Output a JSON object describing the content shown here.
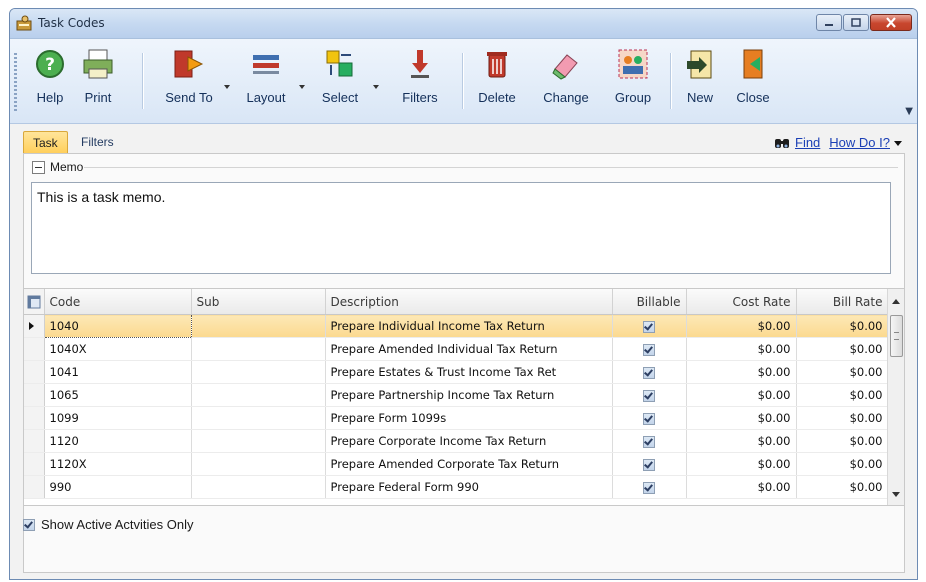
{
  "window": {
    "title": "Task Codes"
  },
  "toolbar": {
    "help": "Help",
    "print": "Print",
    "send_to": "Send To",
    "layout": "Layout",
    "select": "Select",
    "filters": "Filters",
    "delete": "Delete",
    "change": "Change",
    "group": "Group",
    "new": "New",
    "close": "Close"
  },
  "tabs": {
    "task": "Task",
    "filters": "Filters"
  },
  "links": {
    "find": "Find",
    "how_do_i": "How Do I?"
  },
  "memo": {
    "label": "Memo",
    "text": "This is a task memo."
  },
  "grid": {
    "columns": [
      "Code",
      "Sub",
      "Description",
      "Billable",
      "Cost Rate",
      "Bill Rate"
    ],
    "rows": [
      {
        "code": "1040",
        "sub": "",
        "description": "Prepare Individual Income Tax Return",
        "billable": true,
        "cost": "$0.00",
        "bill": "$0.00"
      },
      {
        "code": "1040X",
        "sub": "",
        "description": "Prepare Amended Individual Tax Return",
        "billable": true,
        "cost": "$0.00",
        "bill": "$0.00"
      },
      {
        "code": "1041",
        "sub": "",
        "description": "Prepare Estates & Trust Income Tax Ret",
        "billable": true,
        "cost": "$0.00",
        "bill": "$0.00"
      },
      {
        "code": "1065",
        "sub": "",
        "description": "Prepare Partnership Income Tax Return",
        "billable": true,
        "cost": "$0.00",
        "bill": "$0.00"
      },
      {
        "code": "1099",
        "sub": "",
        "description": "Prepare Form 1099s",
        "billable": true,
        "cost": "$0.00",
        "bill": "$0.00"
      },
      {
        "code": "1120",
        "sub": "",
        "description": "Prepare Corporate Income Tax Return",
        "billable": true,
        "cost": "$0.00",
        "bill": "$0.00"
      },
      {
        "code": "1120X",
        "sub": "",
        "description": "Prepare Amended Corporate Tax Return",
        "billable": true,
        "cost": "$0.00",
        "bill": "$0.00"
      },
      {
        "code": "990",
        "sub": "",
        "description": "Prepare Federal Form 990",
        "billable": true,
        "cost": "$0.00",
        "bill": "$0.00"
      }
    ]
  },
  "footer": {
    "active_only_label": "Show Active Actvities Only",
    "active_only_checked": true
  },
  "colors": {
    "selection": "#fbd98f",
    "title_bar": "#c6d9f1",
    "link": "#1b3fb5"
  }
}
